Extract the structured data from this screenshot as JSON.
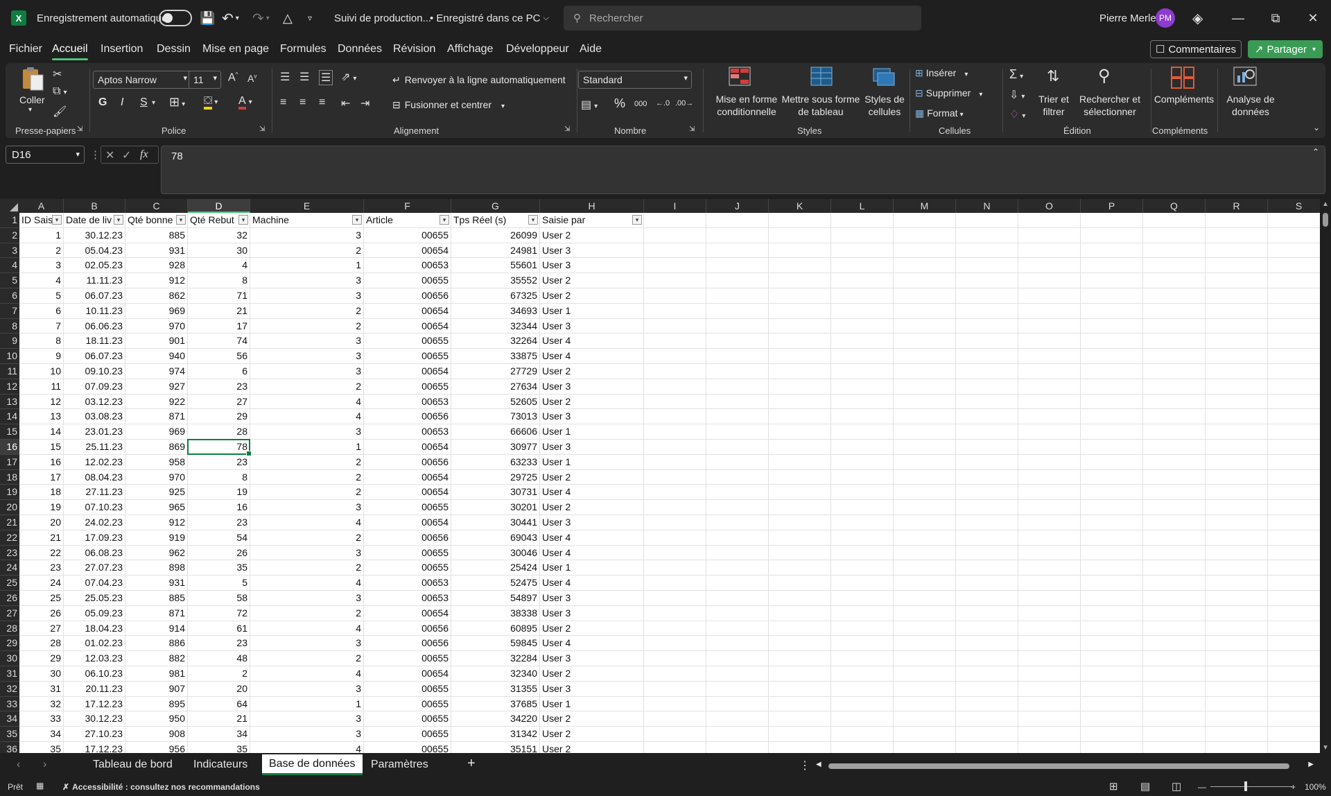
{
  "titlebar": {
    "autosave_label": "Enregistrement automatique",
    "doc_title": "Suivi de production...",
    "save_status": "• Enregistré dans ce PC",
    "search_placeholder": "Rechercher",
    "user_name": "Pierre Merle",
    "user_initials": "PM"
  },
  "menu": {
    "items": [
      "Fichier",
      "Accueil",
      "Insertion",
      "Dessin",
      "Mise en page",
      "Formules",
      "Données",
      "Révision",
      "Affichage",
      "Développeur",
      "Aide"
    ],
    "active": "Accueil",
    "comments_label": "Commentaires",
    "share_label": "Partager"
  },
  "ribbon": {
    "clipboard": {
      "paste_label": "Coller",
      "group_label": "Presse-papiers"
    },
    "font": {
      "font_name": "Aptos Narrow",
      "font_size": "11",
      "bold": "G",
      "italic": "I",
      "underline": "S",
      "group_label": "Police"
    },
    "alignment": {
      "wrap_label": "Renvoyer à la ligne automatiquement",
      "merge_label": "Fusionner et centrer",
      "group_label": "Alignement"
    },
    "number": {
      "format": "Standard",
      "percent": "%",
      "thousands": "000",
      "group_label": "Nombre"
    },
    "styles": {
      "conditional_label": "Mise en forme conditionnelle",
      "table_label": "Mettre sous forme de tableau",
      "cell_styles_label": "Styles de cellules",
      "group_label": "Styles"
    },
    "cells": {
      "insert_label": "Insérer",
      "delete_label": "Supprimer",
      "format_label": "Format",
      "group_label": "Cellules"
    },
    "editing": {
      "sort_label": "Trier et filtrer",
      "find_label": "Rechercher et sélectionner",
      "group_label": "Édition"
    },
    "addins": {
      "addins_label": "Compléments",
      "group_label": "Compléments"
    },
    "analysis": {
      "analysis_label": "Analyse de données"
    }
  },
  "formula_bar": {
    "name_box": "D16",
    "fx": "fx",
    "value": "78"
  },
  "grid": {
    "columns": [
      "A",
      "B",
      "C",
      "D",
      "E",
      "F",
      "G",
      "H",
      "I",
      "J",
      "K",
      "L",
      "M",
      "N",
      "O",
      "P",
      "Q",
      "R",
      "S"
    ],
    "selected_column": "D",
    "selected_row": 16,
    "headers": [
      "ID Sais",
      "Date de liv",
      "Qté bonne",
      "Qté Rebut",
      "Machine",
      "Article",
      "Tps Réel (s)",
      "Saisie par"
    ],
    "rows": [
      [
        "1",
        "30.12.23",
        "885",
        "32",
        "3",
        "00655",
        "26099",
        "User 2"
      ],
      [
        "2",
        "05.04.23",
        "931",
        "30",
        "2",
        "00654",
        "24981",
        "User 3"
      ],
      [
        "3",
        "02.05.23",
        "928",
        "4",
        "1",
        "00653",
        "55601",
        "User 3"
      ],
      [
        "4",
        "11.11.23",
        "912",
        "8",
        "3",
        "00655",
        "35552",
        "User 2"
      ],
      [
        "5",
        "06.07.23",
        "862",
        "71",
        "3",
        "00656",
        "67325",
        "User 2"
      ],
      [
        "6",
        "10.11.23",
        "969",
        "21",
        "2",
        "00654",
        "34693",
        "User 1"
      ],
      [
        "7",
        "06.06.23",
        "970",
        "17",
        "2",
        "00654",
        "32344",
        "User 3"
      ],
      [
        "8",
        "18.11.23",
        "901",
        "74",
        "3",
        "00655",
        "32264",
        "User 4"
      ],
      [
        "9",
        "06.07.23",
        "940",
        "56",
        "3",
        "00655",
        "33875",
        "User 4"
      ],
      [
        "10",
        "09.10.23",
        "974",
        "6",
        "3",
        "00654",
        "27729",
        "User 2"
      ],
      [
        "11",
        "07.09.23",
        "927",
        "23",
        "2",
        "00655",
        "27634",
        "User 3"
      ],
      [
        "12",
        "03.12.23",
        "922",
        "27",
        "4",
        "00653",
        "52605",
        "User 2"
      ],
      [
        "13",
        "03.08.23",
        "871",
        "29",
        "4",
        "00656",
        "73013",
        "User 3"
      ],
      [
        "14",
        "23.01.23",
        "969",
        "28",
        "3",
        "00653",
        "66606",
        "User 1"
      ],
      [
        "15",
        "25.11.23",
        "869",
        "78",
        "1",
        "00654",
        "30977",
        "User 3"
      ],
      [
        "16",
        "12.02.23",
        "958",
        "23",
        "2",
        "00656",
        "63233",
        "User 1"
      ],
      [
        "17",
        "08.04.23",
        "970",
        "8",
        "2",
        "00654",
        "29725",
        "User 2"
      ],
      [
        "18",
        "27.11.23",
        "925",
        "19",
        "2",
        "00654",
        "30731",
        "User 4"
      ],
      [
        "19",
        "07.10.23",
        "965",
        "16",
        "3",
        "00655",
        "30201",
        "User 2"
      ],
      [
        "20",
        "24.02.23",
        "912",
        "23",
        "4",
        "00654",
        "30441",
        "User 3"
      ],
      [
        "21",
        "17.09.23",
        "919",
        "54",
        "2",
        "00656",
        "69043",
        "User 4"
      ],
      [
        "22",
        "06.08.23",
        "962",
        "26",
        "3",
        "00655",
        "30046",
        "User 4"
      ],
      [
        "23",
        "27.07.23",
        "898",
        "35",
        "2",
        "00655",
        "25424",
        "User 1"
      ],
      [
        "24",
        "07.04.23",
        "931",
        "5",
        "4",
        "00653",
        "52475",
        "User 4"
      ],
      [
        "25",
        "25.05.23",
        "885",
        "58",
        "3",
        "00653",
        "54897",
        "User 3"
      ],
      [
        "26",
        "05.09.23",
        "871",
        "72",
        "2",
        "00654",
        "38338",
        "User 3"
      ],
      [
        "27",
        "18.04.23",
        "914",
        "61",
        "4",
        "00656",
        "60895",
        "User 2"
      ],
      [
        "28",
        "01.02.23",
        "886",
        "23",
        "3",
        "00656",
        "59845",
        "User 4"
      ],
      [
        "29",
        "12.03.23",
        "882",
        "48",
        "2",
        "00655",
        "32284",
        "User 3"
      ],
      [
        "30",
        "06.10.23",
        "981",
        "2",
        "4",
        "00654",
        "32340",
        "User 2"
      ],
      [
        "31",
        "20.11.23",
        "907",
        "20",
        "3",
        "00655",
        "31355",
        "User 3"
      ],
      [
        "32",
        "17.12.23",
        "895",
        "64",
        "1",
        "00655",
        "37685",
        "User 1"
      ],
      [
        "33",
        "30.12.23",
        "950",
        "21",
        "3",
        "00655",
        "34220",
        "User 2"
      ],
      [
        "34",
        "27.10.23",
        "908",
        "34",
        "3",
        "00655",
        "31342",
        "User 2"
      ],
      [
        "35",
        "17.12.23",
        "956",
        "35",
        "4",
        "00655",
        "35151",
        "User 2"
      ]
    ]
  },
  "sheets": {
    "tabs": [
      "Tableau de bord",
      "Indicateurs",
      "Base de données",
      "Paramètres"
    ],
    "active": "Base de données"
  },
  "status": {
    "ready": "Prêt",
    "accessibility": "Accessibilité : consultez nos recommandations",
    "zoom": "100%"
  }
}
